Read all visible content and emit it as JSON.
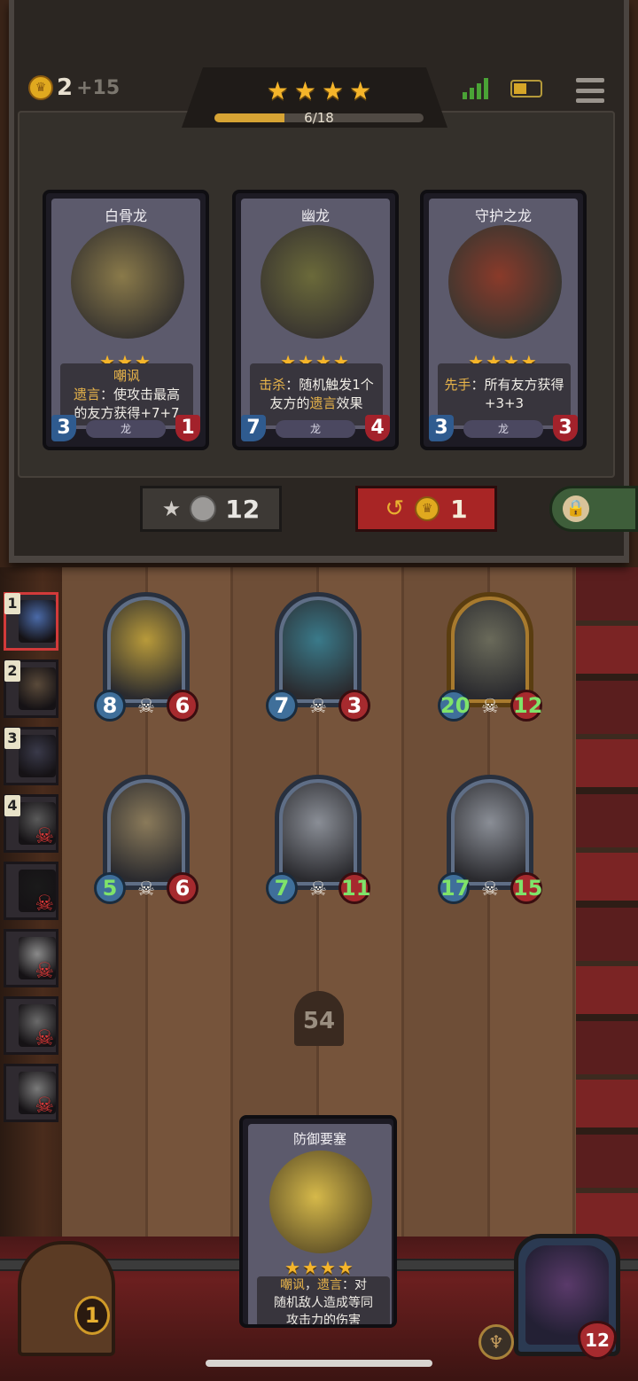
{
  "resources": {
    "gold": "2",
    "income": "+15"
  },
  "tavern": {
    "stars": [
      "★",
      "★",
      "★",
      "★"
    ],
    "xp_text": "6/18",
    "xp_progress": 0.333
  },
  "status_bar": {
    "signal_bars": 4,
    "battery_level": 0.5
  },
  "shop": {
    "cards": [
      {
        "name": "白骨龙",
        "stars": "★★★",
        "keyword": "嘲讽",
        "kw2": "遗言",
        "text1": "：使攻击最高",
        "text2": "的友方获得+7+7",
        "attack": "3",
        "health": "1",
        "tribe": "龙",
        "art_color": "#8a7a4a"
      },
      {
        "name": "幽龙",
        "stars": "★★★★",
        "keyword": "击杀",
        "text1": "：随机触发1个",
        "text2a": "友方的",
        "kw2": "遗言",
        "text2b": "效果",
        "attack": "7",
        "health": "4",
        "tribe": "龙",
        "art_color": "#6b6a3a"
      },
      {
        "name": "守护之龙",
        "stars": "★★★★",
        "keyword": "先手",
        "text1": "：所有友方获得",
        "text2": "+3+3",
        "attack": "3",
        "health": "3",
        "tribe": "龙",
        "art_color": "#8a3a2a"
      }
    ],
    "upgrade_cost": "12",
    "refresh_cost": "1"
  },
  "opponents": [
    {
      "rank": "1",
      "eliminated": false,
      "color": "#4a6aa8",
      "highlight": true
    },
    {
      "rank": "2",
      "eliminated": false,
      "color": "#5a4a3a",
      "highlight": false
    },
    {
      "rank": "3",
      "eliminated": false,
      "color": "#3a3a4a",
      "highlight": false
    },
    {
      "rank": "4",
      "eliminated": true,
      "color": "#5a5a5a",
      "highlight": false
    },
    {
      "rank": "",
      "eliminated": true,
      "color": "#1a1a1a",
      "highlight": false
    },
    {
      "rank": "",
      "eliminated": true,
      "color": "#8a8a8a",
      "highlight": false
    },
    {
      "rank": "",
      "eliminated": true,
      "color": "#6a6a6a",
      "highlight": false
    },
    {
      "rank": "",
      "eliminated": true,
      "color": "#7a7a7a",
      "highlight": false
    }
  ],
  "board": {
    "minions": [
      {
        "attack": "8",
        "health": "6",
        "golden": false,
        "art": "#b89a3a",
        "atk_buffed": false,
        "hp_buffed": false
      },
      {
        "attack": "7",
        "health": "3",
        "golden": false,
        "art": "#3a7a8a",
        "atk_buffed": false,
        "hp_buffed": false
      },
      {
        "attack": "20",
        "health": "12",
        "golden": true,
        "art": "#6a6a5a",
        "atk_buffed": true,
        "hp_buffed": true
      },
      {
        "attack": "5",
        "health": "6",
        "golden": false,
        "art": "#8a7a5a",
        "atk_buffed": true,
        "hp_buffed": false
      },
      {
        "attack": "7",
        "health": "11",
        "golden": false,
        "art": "#8a8e96",
        "atk_buffed": true,
        "hp_buffed": true
      },
      {
        "attack": "17",
        "health": "15",
        "golden": false,
        "art": "#8a8e96",
        "atk_buffed": true,
        "hp_buffed": true
      }
    ]
  },
  "deck_count": "54",
  "hand": {
    "name": "防御要塞",
    "stars": "★★★★",
    "keyword": "嘲讽",
    "kw2": "遗言",
    "sep": "，",
    "text1": "：对",
    "text2": "随机敌人造成等同",
    "text3": "攻击力的伤害"
  },
  "treasure": {
    "count": "1"
  },
  "hero": {
    "health": "12"
  }
}
